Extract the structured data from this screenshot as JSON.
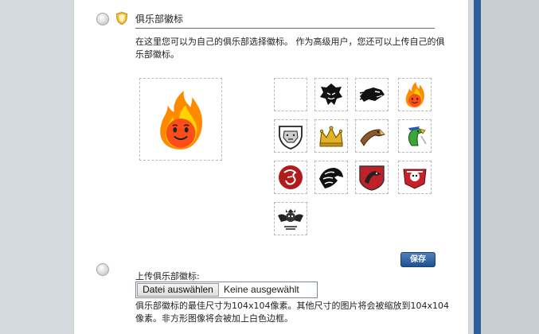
{
  "section": {
    "title": "俱乐部徽标",
    "description": "在这里您可以为自己的俱乐部选择徽标。 作为高级用户，您还可以上传自己的俱乐部徽标。"
  },
  "emblems": [
    {
      "name": "blank",
      "selected": false
    },
    {
      "name": "tribal-tiger",
      "selected": false
    },
    {
      "name": "black-panther",
      "selected": false
    },
    {
      "name": "fireball-face",
      "selected": true
    },
    {
      "name": "bulldog-shield",
      "selected": false
    },
    {
      "name": "golden-crown",
      "selected": false
    },
    {
      "name": "hawk-head",
      "selected": false
    },
    {
      "name": "parrot-pirate",
      "selected": false
    },
    {
      "name": "red-dragon",
      "selected": false
    },
    {
      "name": "eagle-head",
      "selected": false
    },
    {
      "name": "red-eagle-shield",
      "selected": false
    },
    {
      "name": "red-skull-badge",
      "selected": false
    },
    {
      "name": "winged-skull",
      "selected": false
    }
  ],
  "actions": {
    "save_label": "保存"
  },
  "upload": {
    "label": "上传俱乐部徽标:",
    "button_label": "Datei auswählen",
    "status": "Keine ausgewählt",
    "hint": "俱乐部徽标的最佳尺寸为104x104像素。其他尺寸的图片将会被缩放到104x104像素。非方形图像将会被加上白色边框。"
  },
  "colors": {
    "accent_blue": "#2f5e9c",
    "button_blue": "#2b5a9a"
  }
}
